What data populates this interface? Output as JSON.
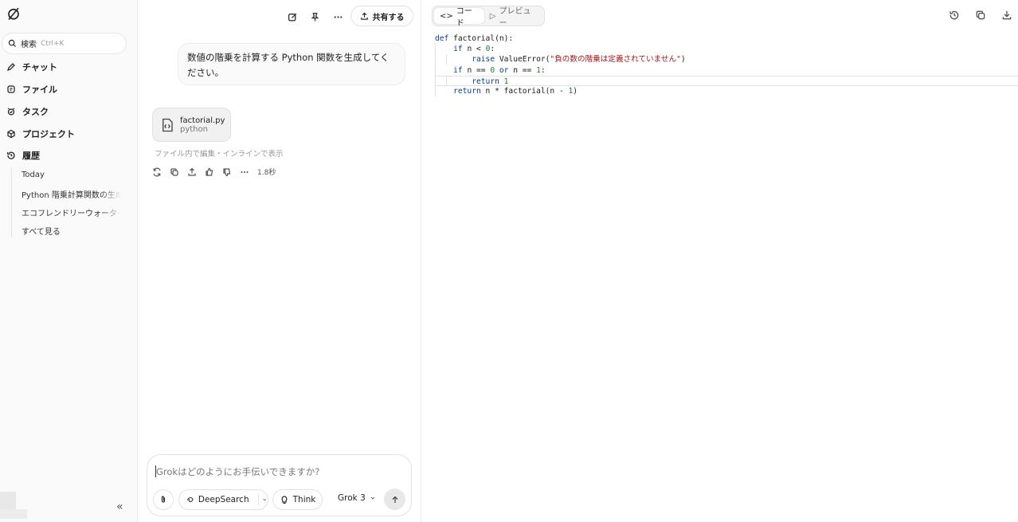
{
  "sidebar": {
    "search_label": "検索",
    "search_shortcut": "Ctrl+K",
    "nav": [
      {
        "label": "チャット",
        "icon": "chat-icon"
      },
      {
        "label": "ファイル",
        "icon": "file-icon"
      },
      {
        "label": "タスク",
        "icon": "task-icon"
      },
      {
        "label": "プロジェクト",
        "icon": "project-icon"
      },
      {
        "label": "履歴",
        "icon": "history-icon"
      }
    ],
    "history": {
      "group": "Today",
      "items": [
        "Python 階乗計算関数の生成",
        "エコフレンドリーウォーター"
      ],
      "see_all": "すべて見る"
    },
    "collapse_glyph": "«"
  },
  "chat": {
    "share_label": "共有する",
    "user_message": "数値の階乗を計算する Python 関数を生成してください。",
    "file": {
      "name": "factorial.py",
      "type": "python"
    },
    "file_hint": "ファイル内で編集・インラインで表示",
    "response_time": "1.8秒",
    "composer": {
      "placeholder": "Grokはどのようにお手伝いできますか?",
      "deepsearch_label": "DeepSearch",
      "think_label": "Think",
      "model_label": "Grok 3"
    }
  },
  "panel": {
    "tabs": [
      {
        "label": "コード",
        "glyph": "<>",
        "active": true
      },
      {
        "label": "プレビュー",
        "glyph": "▷",
        "active": false
      }
    ],
    "code": {
      "l1_def": "def",
      "l1_rest": " factorial(n):",
      "l2_if": "if",
      "l2_rest": " n < ",
      "l2_num": "0",
      "l2_end": ":",
      "l3_raise": "raise",
      "l3_cls": " ValueError(",
      "l3_str": "\"負の数の階乗は定義されていません\"",
      "l3_end": ")",
      "l4_if": "if",
      "l4_a": " n == ",
      "l4_n0": "0",
      "l4_or": " or",
      "l4_b": " n == ",
      "l4_n1": "1",
      "l4_end": ":",
      "l5_return": "return",
      "l5_num": " 1",
      "l6_return": "return",
      "l6_rest": " n * factorial(n - ",
      "l6_num": "1",
      "l6_end": ")"
    }
  }
}
